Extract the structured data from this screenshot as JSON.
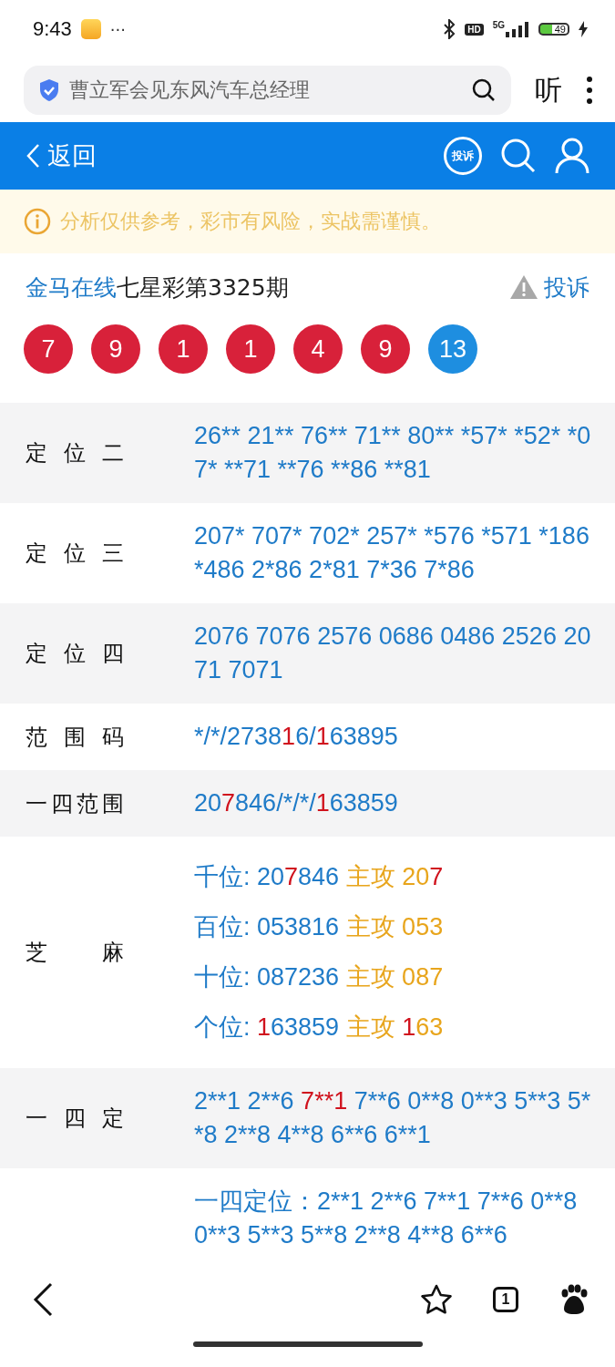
{
  "status_bar": {
    "time": "9:43",
    "more": "···",
    "hd": "HD",
    "network": "5G",
    "battery": "49"
  },
  "address_bar": {
    "query": "曹立军会见东风汽车总经理",
    "listen": "听"
  },
  "header": {
    "back": "返回",
    "complaint_badge": "投诉"
  },
  "notice": "分析仅供参考，彩市有风险，实战需谨慎。",
  "title": {
    "site": "金马在线",
    "issue": "七星彩第3325期",
    "complaint": "投诉"
  },
  "balls": [
    {
      "number": "7",
      "color": "#d8213a"
    },
    {
      "number": "9",
      "color": "#d8213a"
    },
    {
      "number": "1",
      "color": "#d8213a"
    },
    {
      "number": "1",
      "color": "#d8213a"
    },
    {
      "number": "4",
      "color": "#d8213a"
    },
    {
      "number": "9",
      "color": "#d8213a"
    },
    {
      "number": "13",
      "color": "#1e8ee0"
    }
  ],
  "rows": [
    {
      "label": "定 位 二",
      "lines": [
        {
          "parts": [
            {
              "text": "26** 21** 76** 71** 80** *57* *52* *07* **71 **76 **86 **81",
              "kind": "plain"
            }
          ]
        }
      ]
    },
    {
      "label": "定 位 三",
      "lines": [
        {
          "parts": [
            {
              "text": "207* 707* 702* 257* *576 *571 *186 *486 2*86 2*81 7*36 7*86",
              "kind": "plain"
            }
          ]
        }
      ]
    },
    {
      "label": "定 位 四",
      "lines": [
        {
          "parts": [
            {
              "text": "2076 7076 2576 0686 0486 2526 2071 7071",
              "kind": "plain"
            }
          ]
        }
      ]
    },
    {
      "label": "范 围 码",
      "lines": [
        {
          "parts": [
            {
              "text": "*/*/2738",
              "kind": "plain"
            },
            {
              "text": "1",
              "kind": "hit"
            },
            {
              "text": "6/",
              "kind": "plain"
            },
            {
              "text": "1",
              "kind": "hit"
            },
            {
              "text": "63895",
              "kind": "plain"
            }
          ]
        }
      ]
    },
    {
      "label": "一四范围",
      "lines": [
        {
          "parts": [
            {
              "text": "20",
              "kind": "plain"
            },
            {
              "text": "7",
              "kind": "hit"
            },
            {
              "text": "846/*/*/",
              "kind": "plain"
            },
            {
              "text": "1",
              "kind": "hit"
            },
            {
              "text": "63859",
              "kind": "plain"
            }
          ]
        }
      ]
    },
    {
      "label": "芝 麻",
      "lines": [
        {
          "parts": [
            {
              "text": "千位: 20",
              "kind": "plain"
            },
            {
              "text": "7",
              "kind": "hit"
            },
            {
              "text": "846 ",
              "kind": "plain"
            },
            {
              "text": "主攻 20",
              "kind": "attack"
            },
            {
              "text": "7",
              "kind": "hit"
            }
          ]
        },
        {
          "parts": [
            {
              "text": "百位: 053816 ",
              "kind": "plain"
            },
            {
              "text": "主攻 053",
              "kind": "attack"
            }
          ]
        },
        {
          "parts": [
            {
              "text": "十位: 087236 ",
              "kind": "plain"
            },
            {
              "text": "主攻 087",
              "kind": "attack"
            }
          ]
        },
        {
          "parts": [
            {
              "text": "个位: ",
              "kind": "plain"
            },
            {
              "text": "1",
              "kind": "hit"
            },
            {
              "text": "63859 ",
              "kind": "plain"
            },
            {
              "text": "主攻 ",
              "kind": "attack"
            },
            {
              "text": "1",
              "kind": "hit"
            },
            {
              "text": "63",
              "kind": "attack"
            }
          ]
        }
      ]
    },
    {
      "label": "一 四 定",
      "lines": [
        {
          "parts": [
            {
              "text": "2**1 2**6 ",
              "kind": "plain"
            },
            {
              "text": "7**1",
              "kind": "hit"
            },
            {
              "text": " 7**6 0**8 0**3 5**3 5**8 2**8 4**8 6**6 6**1",
              "kind": "plain"
            }
          ]
        }
      ]
    },
    {
      "lines": [
        {
          "parts": [
            {
              "text": "一四定位：2**1 2**6 7**1 7**6 0**8 0**3 5**3 5**8 2**8 4**8 6**6",
              "kind": "plain"
            }
          ]
        }
      ]
    }
  ],
  "bottom_bar": {
    "tabs": "1"
  }
}
